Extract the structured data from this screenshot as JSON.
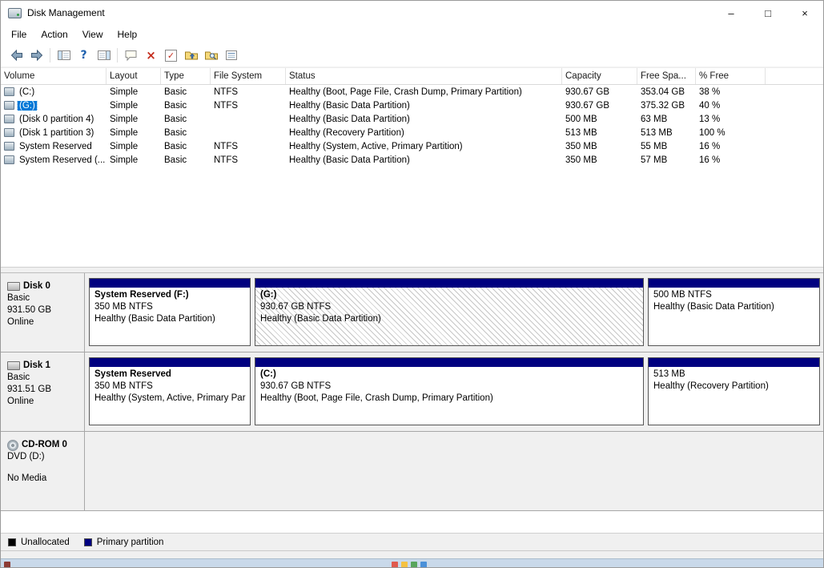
{
  "colors": {
    "selection": "#0078d7",
    "primary_partition": "#000080",
    "unallocated": "#000000"
  },
  "titlebar": {
    "title": "Disk Management",
    "minimize": "–",
    "maximize": "□",
    "close": "×"
  },
  "menu": {
    "file": "File",
    "action": "Action",
    "view": "View",
    "help": "Help"
  },
  "toolbar": {
    "icons": [
      "back",
      "forward",
      "console-tree-toggle",
      "help",
      "action-pane-toggle",
      "tooltip",
      "delete",
      "checkmark-document",
      "folder-up",
      "folder-search",
      "details-list"
    ],
    "help_glyph": "?",
    "delete_glyph": "×",
    "check_glyph": "✓"
  },
  "volume_list": {
    "columns": [
      "Volume",
      "Layout",
      "Type",
      "File System",
      "Status",
      "Capacity",
      "Free Spa...",
      "% Free"
    ],
    "rows": [
      {
        "volume": "(C:)",
        "layout": "Simple",
        "type": "Basic",
        "fs": "NTFS",
        "status": "Healthy (Boot, Page File, Crash Dump, Primary Partition)",
        "capacity": "930.67 GB",
        "free": "353.04 GB",
        "pct": "38 %"
      },
      {
        "volume": "(G:)",
        "layout": "Simple",
        "type": "Basic",
        "fs": "NTFS",
        "status": "Healthy (Basic Data Partition)",
        "capacity": "930.67 GB",
        "free": "375.32 GB",
        "pct": "40 %"
      },
      {
        "volume": "(Disk 0 partition 4)",
        "layout": "Simple",
        "type": "Basic",
        "fs": "",
        "status": "Healthy (Basic Data Partition)",
        "capacity": "500 MB",
        "free": "63 MB",
        "pct": "13 %"
      },
      {
        "volume": "(Disk 1 partition 3)",
        "layout": "Simple",
        "type": "Basic",
        "fs": "",
        "status": "Healthy (Recovery Partition)",
        "capacity": "513 MB",
        "free": "513 MB",
        "pct": "100 %"
      },
      {
        "volume": "System Reserved",
        "layout": "Simple",
        "type": "Basic",
        "fs": "NTFS",
        "status": "Healthy (System, Active, Primary Partition)",
        "capacity": "350 MB",
        "free": "55 MB",
        "pct": "16 %"
      },
      {
        "volume": "System Reserved (...",
        "layout": "Simple",
        "type": "Basic",
        "fs": "NTFS",
        "status": "Healthy (Basic Data Partition)",
        "capacity": "350 MB",
        "free": "57 MB",
        "pct": "16 %"
      }
    ]
  },
  "disks": [
    {
      "name": "Disk 0",
      "kind": "Basic",
      "size": "931.50 GB",
      "state": "Online",
      "partitions": [
        {
          "name": "System Reserved (F:)",
          "size": "350 MB NTFS",
          "status": "Healthy (Basic Data Partition)"
        },
        {
          "name": "(G:)",
          "size": "930.67 GB NTFS",
          "status": "Healthy (Basic Data Partition)"
        },
        {
          "name": "",
          "size": "500 MB NTFS",
          "status": "Healthy (Basic Data Partition)"
        }
      ]
    },
    {
      "name": "Disk 1",
      "kind": "Basic",
      "size": "931.51 GB",
      "state": "Online",
      "partitions": [
        {
          "name": "System Reserved",
          "size": "350 MB NTFS",
          "status": "Healthy (System, Active, Primary Par"
        },
        {
          "name": "(C:)",
          "size": "930.67 GB NTFS",
          "status": "Healthy (Boot, Page File, Crash Dump, Primary Partition)"
        },
        {
          "name": "",
          "size": "513 MB",
          "status": "Healthy (Recovery Partition)"
        }
      ]
    }
  ],
  "cdrom": {
    "name": "CD-ROM 0",
    "media": "DVD (D:)",
    "status": "No Media"
  },
  "legend": {
    "unallocated": "Unallocated",
    "primary": "Primary partition"
  }
}
